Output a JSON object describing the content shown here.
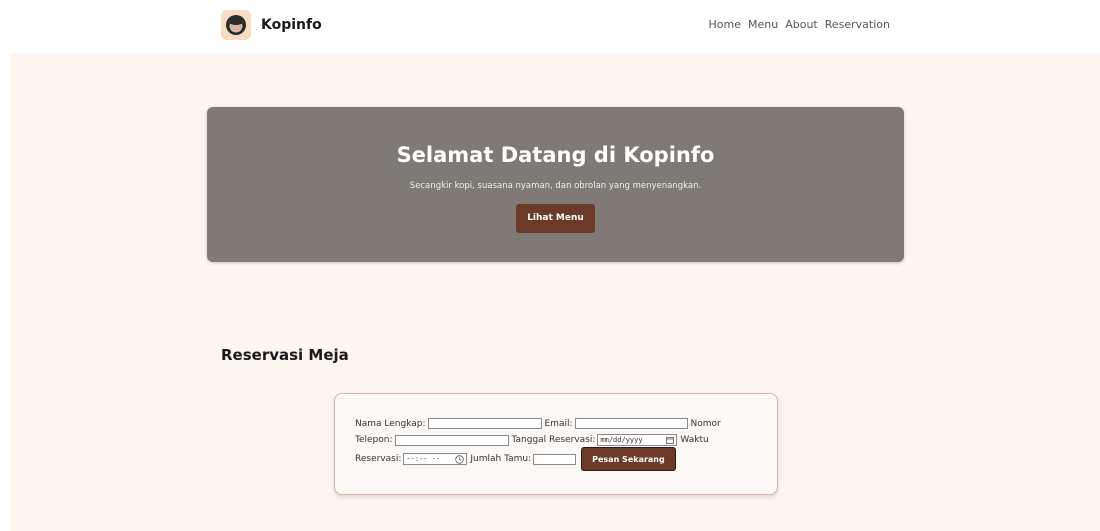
{
  "header": {
    "brand": "Kopinfo",
    "logo_icon": "coffee-logo-icon",
    "nav": [
      "Home",
      "Menu",
      "About",
      "Reservation"
    ]
  },
  "hero": {
    "title": "Selamat Datang di Kopinfo",
    "subtitle": "Secangkir kopi, suasana nyaman, dan obrolan yang menyenangkan.",
    "button": "Lihat Menu"
  },
  "reservation": {
    "title": "Reservasi Meja",
    "full_name_label": "Nama Lengkap:",
    "email_label": "Email:",
    "phone_label_1": "Nomor",
    "phone_label_2": "Telepon:",
    "date_label": "Tanggal Reservasi:",
    "date_placeholder": "mm/dd/yyyy",
    "time_label_1": "Waktu",
    "time_label_2": "Reservasi:",
    "time_placeholder": "--:-- --",
    "guests_label": "Jumlah Tamu:",
    "submit": "Pesan Sekarang"
  },
  "colors": {
    "accent": "#6b3a28",
    "page_bg": "#fdf5f0",
    "hero_bg": "#7f7a76"
  }
}
